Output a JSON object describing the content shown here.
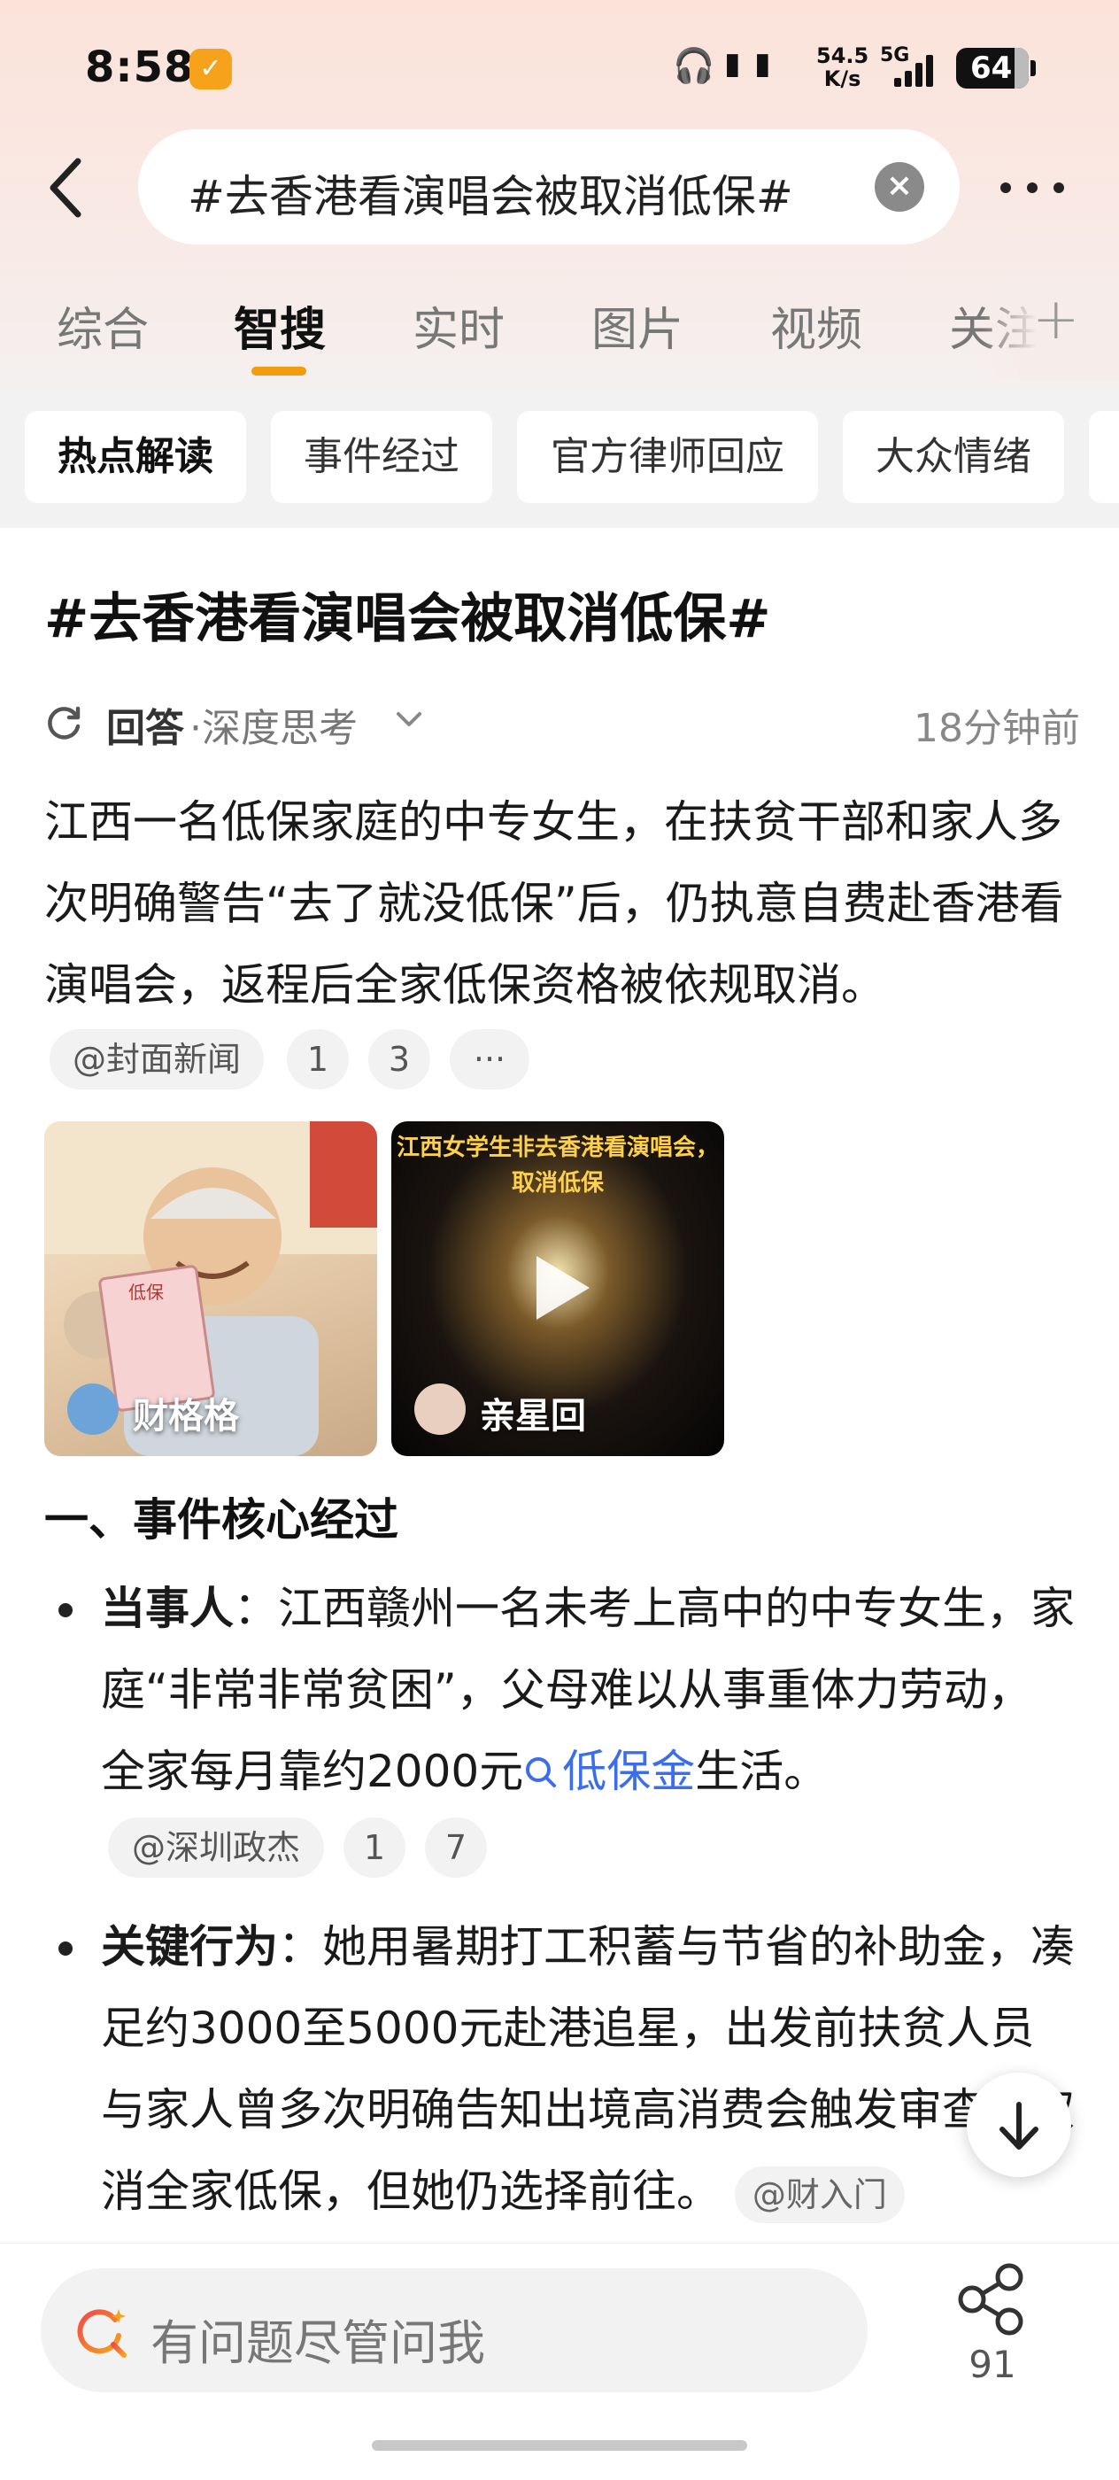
{
  "status_bar": {
    "time": "8:58",
    "net_speed_value": "54.5",
    "net_speed_unit": "K/s",
    "network": "5G",
    "battery": "64"
  },
  "header": {
    "search_query": "#去香港看演唱会被取消低保#"
  },
  "tabs": [
    {
      "label": "综合",
      "active": false
    },
    {
      "label": "智搜",
      "active": true
    },
    {
      "label": "实时",
      "active": false
    },
    {
      "label": "图片",
      "active": false
    },
    {
      "label": "视频",
      "active": false
    },
    {
      "label": "关注",
      "active": false
    }
  ],
  "chips": [
    {
      "label": "热点解读",
      "active": true
    },
    {
      "label": "事件经过",
      "active": false
    },
    {
      "label": "官方律师回应",
      "active": false
    },
    {
      "label": "大众情绪",
      "active": false
    }
  ],
  "content": {
    "title": "#去香港看演唱会被取消低保#",
    "answer_label": "回答",
    "mode_label": "·深度思考",
    "time_ago": "18分钟前",
    "summary": "江西一名低保家庭的中专女生，在扶贫干部和家人多次明确警告“去了就没低保”后，仍执意自费赴香港看演唱会，返程后全家低保资格被依规取消。",
    "summary_sources": [
      "@封面新闻",
      "1",
      "3",
      "···"
    ],
    "media": [
      {
        "author": "财格格",
        "caption": ""
      },
      {
        "author": "亲星回",
        "caption": "江西女学生非去香港看演唱会，取消低保"
      }
    ],
    "section_title": "一、事件核心经过",
    "bullets": [
      {
        "head": "当事人",
        "text": "：江西赣州一名未考上高中的中专女生，家庭“非常非常贫困”，父母难以从事重体力劳动，全家每月靠约2000元",
        "link": "低保金",
        "tail": "生活。",
        "sources": [
          "@深圳政杰",
          "1",
          "7"
        ]
      },
      {
        "head": "关键行为",
        "text": "：她用暑期打工积蓄与节省的补助金，凑足约3000至5000元赴港追星，出发前扶贫人员与家人曾多次明确告知出境高消费会触发审查并取消全家低保，但她仍选择前往。",
        "source": "@财入门"
      }
    ]
  },
  "bottom": {
    "ask_placeholder": "有问题尽管问我",
    "share_count": "91"
  }
}
